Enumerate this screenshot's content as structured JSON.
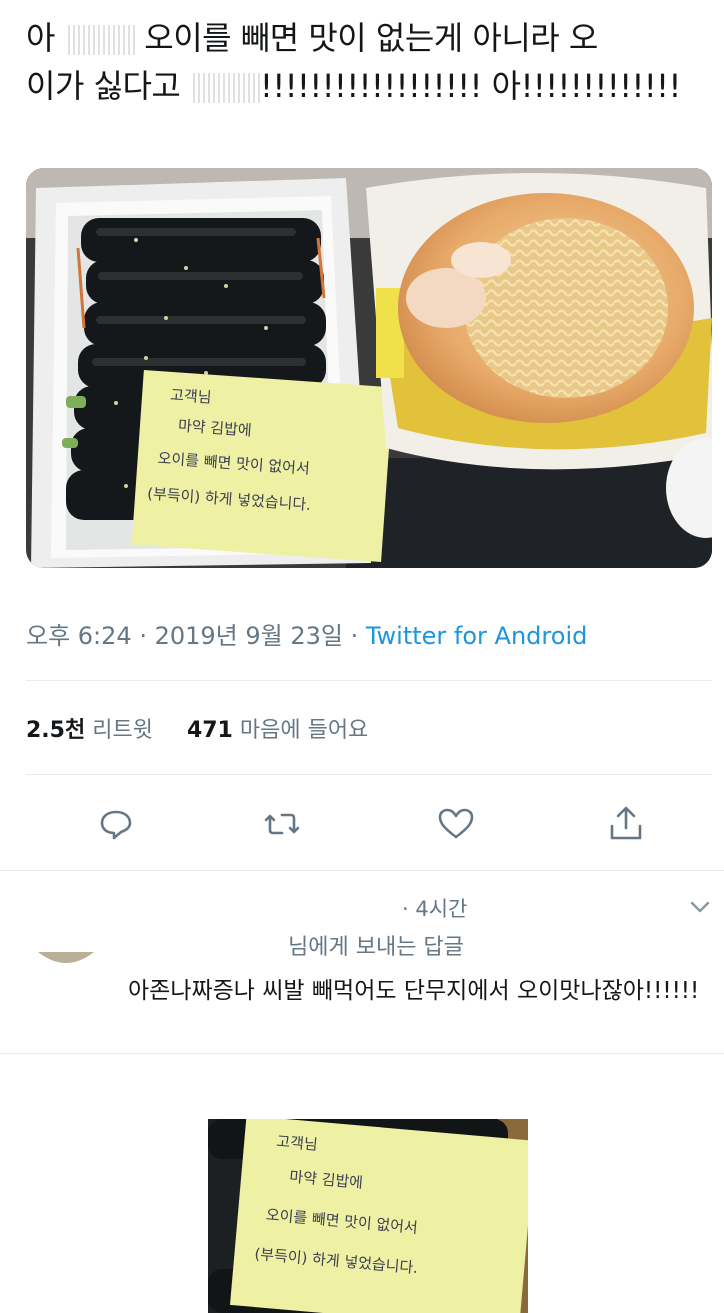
{
  "tweet": {
    "line1_start": "아",
    "line1_end": "오이를 빼면 맛이 없는게 아니라 오",
    "line2_start": "이가 싫다고",
    "line2_end": "!!!!!!!!!!!!!!!!!! 아!!!!!!!!!!!!!"
  },
  "note": {
    "line1": "고객님",
    "line2": "마약 김밥에",
    "line3": "오이를 빼면 맛이 없어서",
    "line4": "(부득이) 하게 넣었습니다."
  },
  "meta": {
    "time": "오후 6:24",
    "sep1": " · ",
    "date": "2019년 9월 23일",
    "sep2": " · ",
    "source": "Twitter for Android"
  },
  "stats": {
    "retweets_count": "2.5천",
    "retweets_label": " 리트윗",
    "likes_count": "471",
    "likes_label": " 마음에 들어요"
  },
  "reply": {
    "time": "· 4시간",
    "reply_to": "님에게 보내는 답글",
    "text": "아존나짜증나 씨발 빼먹어도 단무지에서 오이맛나잖아!!!!!!"
  },
  "icons": {
    "reply": "reply-icon",
    "retweet": "retweet-icon",
    "like": "heart-icon",
    "share": "share-icon",
    "more": "chevron-down-icon"
  },
  "colors": {
    "text": "#14171a",
    "secondary": "#657786",
    "link": "#1b95e0",
    "divider": "#e6ecf0",
    "note": "#eef0a4"
  }
}
